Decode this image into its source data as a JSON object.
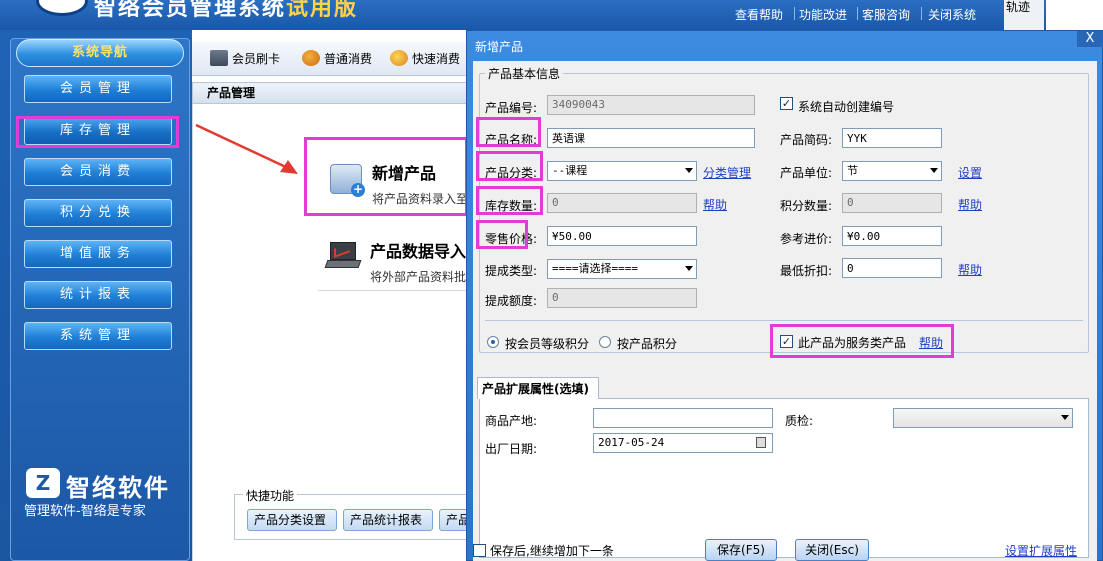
{
  "app": {
    "title": "智络会员管理系统",
    "edition": "试用版",
    "header_links": [
      "查看帮助",
      "功能改进",
      "客服咨询",
      "关闭系统"
    ],
    "header_extra": "轨迹"
  },
  "sidebar": {
    "header": "系统导航",
    "items": [
      {
        "label": "会员管理"
      },
      {
        "label": "库存管理"
      },
      {
        "label": "会员消费"
      },
      {
        "label": "积分兑换"
      },
      {
        "label": "增值服务"
      },
      {
        "label": "统计报表"
      },
      {
        "label": "系统管理"
      }
    ],
    "brand_name": "智络软件",
    "slogan": "管理软件-智络是专家"
  },
  "toolbar": {
    "items": [
      "会员刷卡",
      "普通消费",
      "快速消费"
    ]
  },
  "panel": {
    "title": "产品管理",
    "entries": [
      {
        "title": "新增产品",
        "desc": "将产品资料录入至"
      },
      {
        "title": "产品数据导入",
        "desc": "将外部产品资料批"
      }
    ],
    "quick": {
      "legend": "快捷功能",
      "buttons": [
        "产品分类设置",
        "产品统计报表",
        "产品"
      ]
    }
  },
  "dialog": {
    "title": "新增产品",
    "close": "X",
    "basic_group": "产品基本信息",
    "fields": {
      "code_label": "产品编号:",
      "code_value": "34090043",
      "auto_code_label": "系统自动创建编号",
      "name_label": "产品名称:",
      "name_value": "英语课",
      "short_label": "产品简码:",
      "short_value": "YYK",
      "category_label": "产品分类:",
      "category_value": "--课程",
      "category_link": "分类管理",
      "unit_label": "产品单位:",
      "unit_value": "节",
      "unit_link": "设置",
      "stock_label": "库存数量:",
      "stock_value": "0",
      "stock_help": "帮助",
      "points_label": "积分数量:",
      "points_value": "0",
      "points_help": "帮助",
      "price_label": "零售价格:",
      "price_value": "¥50.00",
      "ref_price_label": "参考进价:",
      "ref_price_value": "¥0.00",
      "commission_type_label": "提成类型:",
      "commission_type_value": "====请选择====",
      "min_discount_label": "最低折扣:",
      "min_discount_value": "0",
      "discount_help": "帮助",
      "commission_amount_label": "提成额度:",
      "commission_amount_value": "0"
    },
    "points_mode": {
      "by_level": "按会员等级积分",
      "by_product": "按产品积分",
      "selected": "by_level"
    },
    "service_product_label": "此产品为服务类产品",
    "service_help": "帮助",
    "ext_tab": "产品扩展属性(选填)",
    "ext": {
      "origin_label": "商品产地:",
      "origin_value": "",
      "qc_label": "质检:",
      "qc_value": "",
      "date_label": "出厂日期:",
      "date_value": "2017-05-24",
      "ext_link": "设置扩展属性"
    },
    "footer": {
      "continue_label": "保存后,继续增加下一条",
      "save": "保存(F5)",
      "close": "关闭(Esc)"
    }
  },
  "colors": {
    "accent_highlight": "#e43ad6",
    "title_bar": "#2b74cc",
    "link": "#1f3fc4"
  }
}
